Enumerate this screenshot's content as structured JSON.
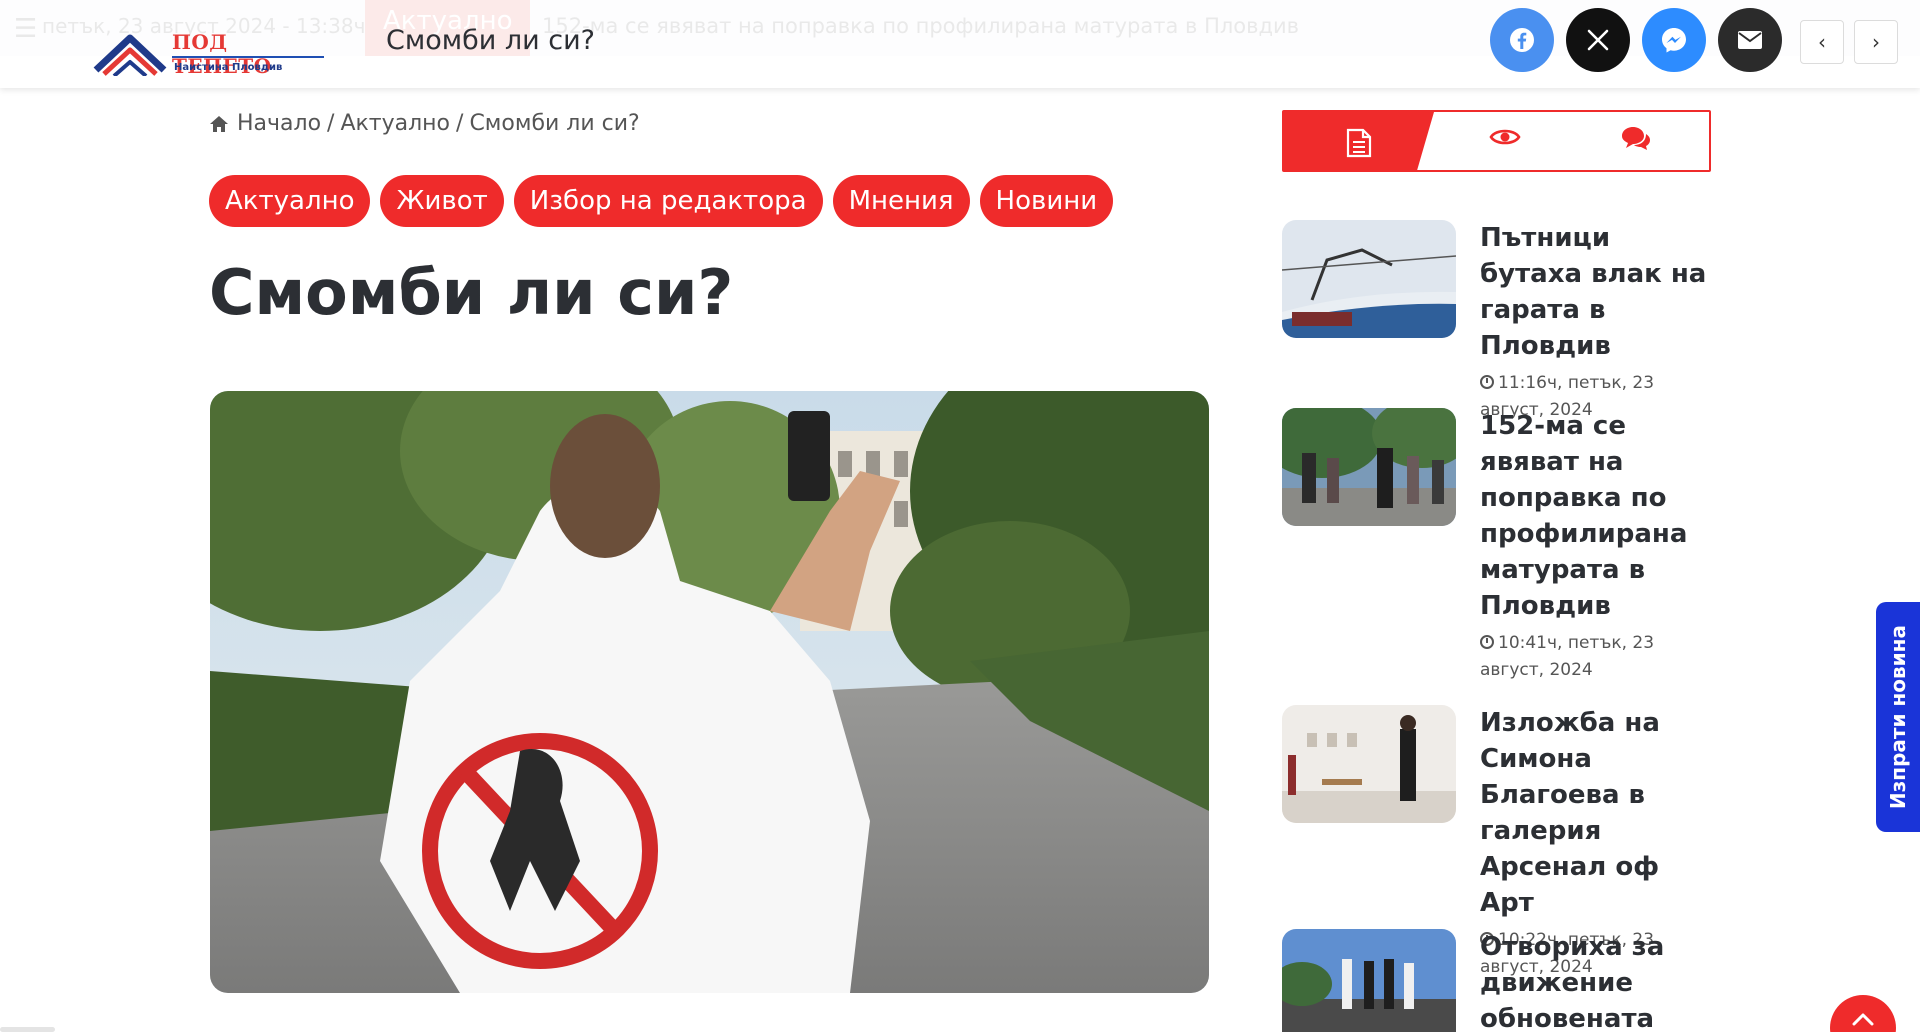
{
  "ticker": {
    "date": "петък, 23 август 2024 - 13:38ч",
    "label": "Актуално",
    "headline": "152-ма се явяват на поправка по профилирана матурата в Пловдив"
  },
  "header": {
    "logo_name": "ПОД ТЕПЕТО",
    "logo_tagline": "Наистина Пловдив",
    "title": "Смомби ли си?",
    "share_icons": [
      "facebook-icon",
      "x-icon",
      "messenger-icon",
      "envelope-icon"
    ],
    "prev_label": "‹",
    "next_label": "›"
  },
  "breadcrumb": {
    "home": "Начало",
    "section": "Актуално",
    "current": "Смомби ли си?",
    "separator": "/"
  },
  "categories": [
    "Актуално",
    "Живот",
    "Избор на редактора",
    "Мнения",
    "Новини"
  ],
  "article": {
    "title": "Смомби ли си?"
  },
  "sidebar": {
    "tabs": [
      "recent-posts-icon",
      "eye-icon",
      "comments-icon"
    ],
    "posts": [
      {
        "title": "Пътници бутаха влак на гарата в Пловдив",
        "time": "11:16ч, петък, 23 август, 2024"
      },
      {
        "title": "152-ма се явяват на поправка по профилирана матурата в Пловдив",
        "time": "10:41ч, петък, 23 август, 2024"
      },
      {
        "title": "Изложба на Симона Благоева в галерия Арсенал оф Арт",
        "time": "10:22ч, петък, 23 август, 2024"
      },
      {
        "title": "Отвориха за движение обновената",
        "time": ""
      }
    ]
  },
  "floating": {
    "send_news": "Изпрати новина"
  },
  "colors": {
    "accent": "#ef2b2b",
    "send_news": "#1a34d8",
    "facebook": "#4a90f0",
    "messenger": "#2d8cff"
  }
}
